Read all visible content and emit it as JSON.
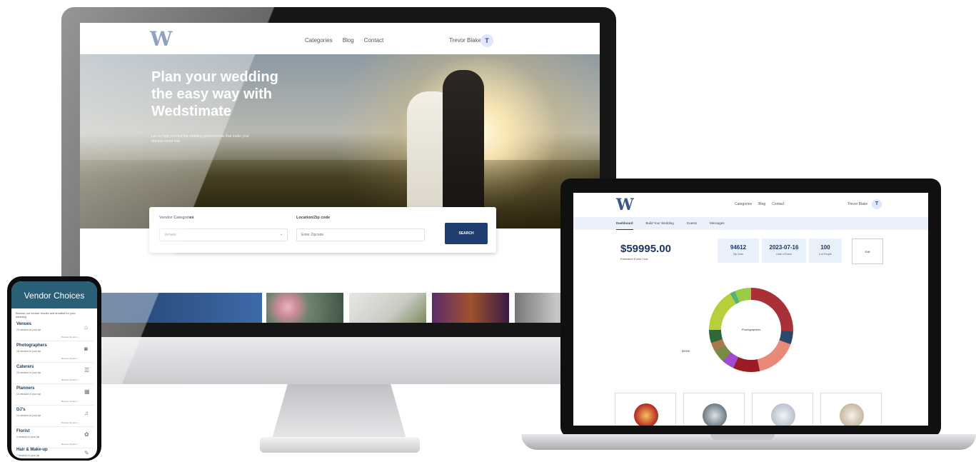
{
  "desktop": {
    "logo": "W",
    "nav_links": [
      "Categories",
      "Blog",
      "Contact"
    ],
    "user_name": "Trevor Blake",
    "avatar_initial": "T",
    "hero_title": "Plan your wedding the easy way with Wedstimate",
    "hero_subtitle": "Let us help you find the wedding professionals that make your dreams come true",
    "search": {
      "category_label": "Vendor Categories",
      "category_value": "Venues",
      "location_label": "Location/Zip code",
      "location_placeholder": "Enter Zipcode",
      "button_label": "SEARCH"
    }
  },
  "laptop": {
    "logo": "W",
    "nav_links": [
      "Categories",
      "Blog",
      "Contact"
    ],
    "user_name": "Trevor Blake",
    "avatar_initial": "T",
    "tabs": [
      "Dashboard",
      "Build Your Wedding",
      "Guests",
      "Messages"
    ],
    "estimated_cost": "$59995.00",
    "estimated_cost_label": "Estimated Event Cost",
    "stats": [
      {
        "value": "94612",
        "label": "Zip Code"
      },
      {
        "value": "2023-07-16",
        "label": "Date of Event"
      },
      {
        "value": "100",
        "label": "# of People"
      }
    ],
    "edit_label": "Edit",
    "donut_center": "Photographers",
    "donut_callout": "$2000"
  },
  "phone": {
    "header": "Vendor Choices",
    "intro": "Browse our vendor results and shortlist for your wedding",
    "items": [
      {
        "title": "Venues",
        "sub": "20 vendors in your zip",
        "link": "Browse Vendors >"
      },
      {
        "title": "Photographers",
        "sub": "18 vendors in your zip",
        "link": "Browse Vendors >"
      },
      {
        "title": "Caterers",
        "sub": "15 vendors in your zip",
        "link": "Browse Vendors >"
      },
      {
        "title": "Planners",
        "sub": "12 vendors in your zip",
        "link": "Browse Vendors >"
      },
      {
        "title": "DJ's",
        "sub": "10 vendors in your zip",
        "link": "Browse Vendors >"
      },
      {
        "title": "Florist",
        "sub": "9 vendors in your zip",
        "link": "Browse Vendors >"
      },
      {
        "title": "Hair & Make-up",
        "sub": "7 vendors in your zip",
        "link": ""
      }
    ]
  }
}
